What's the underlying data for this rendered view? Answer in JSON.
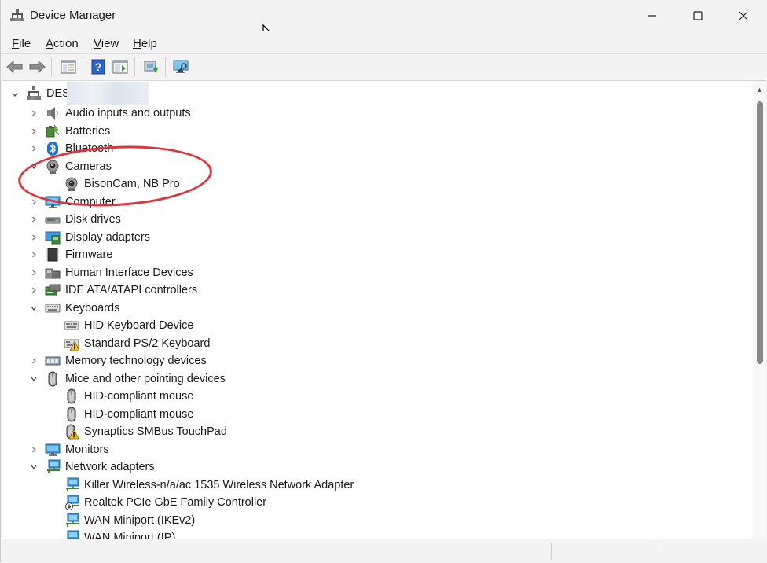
{
  "window": {
    "title": "Device Manager"
  },
  "menu": {
    "file": {
      "hot": "F",
      "rest": "ile"
    },
    "action": {
      "hot": "A",
      "rest": "ction"
    },
    "view": {
      "hot": "V",
      "rest": "iew"
    },
    "help": {
      "hot": "H",
      "rest": "elp"
    }
  },
  "toolbar": {
    "buttons": [
      "back-arrow-icon",
      "forward-arrow-icon",
      "show-hide-console-tree-icon",
      "help-icon",
      "properties-icon",
      "update-driver-icon",
      "scan-hardware-icon"
    ]
  },
  "tree": {
    "root": "DES",
    "items": [
      {
        "label": "Audio inputs and outputs",
        "icon": "speaker-icon",
        "level": 1,
        "expanded": false
      },
      {
        "label": "Batteries",
        "icon": "battery-icon",
        "level": 1,
        "expanded": false
      },
      {
        "label": "Bluetooth",
        "icon": "bluetooth-icon",
        "level": 1,
        "expanded": false
      },
      {
        "label": "Cameras",
        "icon": "camera-icon",
        "level": 1,
        "expanded": true
      },
      {
        "label": "BisonCam, NB Pro",
        "icon": "camera-icon",
        "level": 2
      },
      {
        "label": "Computer",
        "icon": "monitor-icon",
        "level": 1,
        "expanded": false
      },
      {
        "label": "Disk drives",
        "icon": "disk-drive-icon",
        "level": 1,
        "expanded": false
      },
      {
        "label": "Display adapters",
        "icon": "display-adapter-icon",
        "level": 1,
        "expanded": false
      },
      {
        "label": "Firmware",
        "icon": "chip-icon",
        "level": 1,
        "expanded": false
      },
      {
        "label": "Human Interface Devices",
        "icon": "hid-icon",
        "level": 1,
        "expanded": false
      },
      {
        "label": "IDE ATA/ATAPI controllers",
        "icon": "ide-controller-icon",
        "level": 1,
        "expanded": false
      },
      {
        "label": "Keyboards",
        "icon": "keyboard-icon",
        "level": 1,
        "expanded": true
      },
      {
        "label": "HID Keyboard Device",
        "icon": "keyboard-icon",
        "level": 2
      },
      {
        "label": "Standard PS/2 Keyboard",
        "icon": "keyboard-warning-icon",
        "level": 2
      },
      {
        "label": "Memory technology devices",
        "icon": "memory-icon",
        "level": 1,
        "expanded": false
      },
      {
        "label": "Mice and other pointing devices",
        "icon": "mouse-icon",
        "level": 1,
        "expanded": true
      },
      {
        "label": "HID-compliant mouse",
        "icon": "mouse-icon",
        "level": 2
      },
      {
        "label": "HID-compliant mouse",
        "icon": "mouse-icon",
        "level": 2
      },
      {
        "label": "Synaptics SMBus TouchPad",
        "icon": "mouse-warning-icon",
        "level": 2
      },
      {
        "label": "Monitors",
        "icon": "monitor-icon",
        "level": 1,
        "expanded": false
      },
      {
        "label": "Network adapters",
        "icon": "network-icon",
        "level": 1,
        "expanded": true
      },
      {
        "label": "Killer Wireless-n/a/ac 1535 Wireless Network Adapter",
        "icon": "network-icon",
        "level": 2
      },
      {
        "label": "Realtek PCIe GbE Family Controller",
        "icon": "network-down-icon",
        "level": 2
      },
      {
        "label": "WAN Miniport (IKEv2)",
        "icon": "network-icon",
        "level": 2
      },
      {
        "label": "WAN Miniport (IP)",
        "icon": "network-icon",
        "level": 2
      }
    ]
  },
  "colors": {
    "highlight": "#d9363e",
    "accent": "#1f7fd1"
  }
}
